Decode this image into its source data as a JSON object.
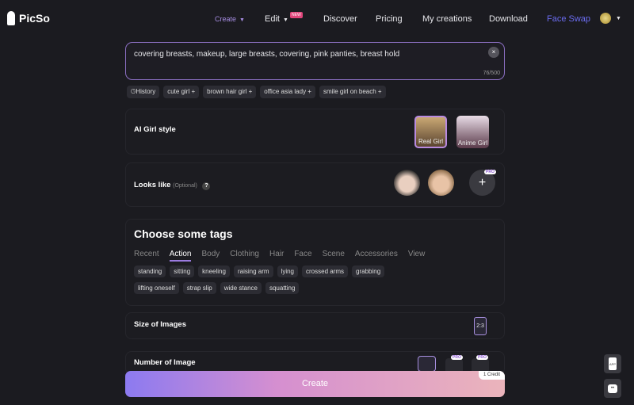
{
  "nav": {
    "brand": "PicSo",
    "items": [
      {
        "label": "Create"
      },
      {
        "label": "Edit",
        "badge": "NEW"
      },
      {
        "label": "Discover"
      },
      {
        "label": "Pricing"
      },
      {
        "label": "My creations"
      },
      {
        "label": "Download"
      },
      {
        "label": "Face Swap"
      }
    ]
  },
  "prompt": {
    "value": "covering breasts, makeup, large breasts, covering, pink panties, breast hold",
    "count": "76/500",
    "clear": "×"
  },
  "chips": {
    "history": "History",
    "items": [
      "cute girl",
      "brown hair girl",
      "office asia lady",
      "smile girl on beach"
    ]
  },
  "style": {
    "title": "AI Girl style",
    "options": [
      "Real Girl",
      "Anime Girl"
    ]
  },
  "looks": {
    "title": "Looks like",
    "optional": "(Optional)",
    "help": "?",
    "add": "+",
    "pro": "PRO"
  },
  "tags": {
    "title": "Choose some tags",
    "tabs": [
      "Recent",
      "Action",
      "Body",
      "Clothing",
      "Hair",
      "Face",
      "Scene",
      "Accessories",
      "View"
    ],
    "row1": [
      "standing",
      "sitting",
      "kneeling",
      "raising arm",
      "lying",
      "crossed arms",
      "grabbing"
    ],
    "row2": [
      "lifting oneself",
      "strap slip",
      "wide stance",
      "squatting"
    ]
  },
  "size": {
    "title": "Size of Images",
    "ratio": "2:3"
  },
  "number": {
    "title": "Number of Image",
    "pro": "PRO"
  },
  "create": {
    "label": "Create",
    "credit": "1 Credit"
  },
  "side": {
    "app": "APP"
  },
  "colors": {
    "accent": "#9b7be0",
    "face_swap": "#6b6cf0"
  }
}
